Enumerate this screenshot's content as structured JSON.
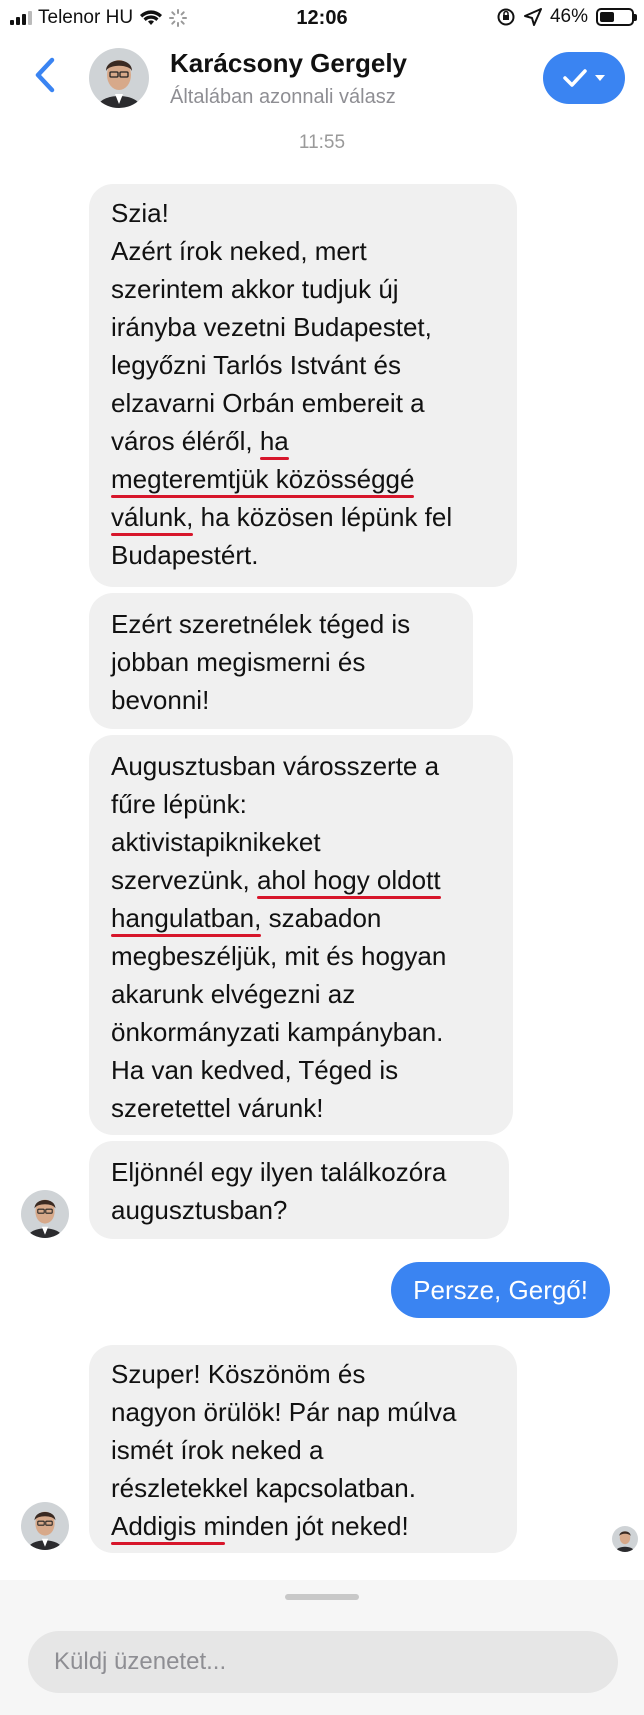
{
  "status": {
    "carrier": "Telenor HU",
    "time": "12:06",
    "battery": "46%",
    "battery_level": 0.46
  },
  "header": {
    "name": "Karácsony Gergely",
    "subtitle": "Általában azonnali válasz"
  },
  "conversation": {
    "timestamp": "11:55",
    "msg1": {
      "l1": "Szia!",
      "l2": "Azért írok neked, mert",
      "l3": "szerintem akkor tudjuk új",
      "l4": "irányba vezetni Budapestet,",
      "l5": "legyőzni Tarlós Istvánt és",
      "l6": "elzavarni Orbán embereit a",
      "l7a": "város éléről, ",
      "l7b": "ha",
      "l8": "megteremtjük közösséggé",
      "l9a": "válunk,",
      "l9b": " ha közösen lépünk fel",
      "l10": "Budapestért."
    },
    "msg2": {
      "l1": "Ezért szeretnélek téged is",
      "l2": "jobban megismerni és",
      "l3": "bevonni!"
    },
    "msg3": {
      "l1": "Augusztusban városszerte a",
      "l2": "fűre lépünk:",
      "l3": "aktivistapiknikeket",
      "l4a": "szervezünk, ",
      "l4b": "ahol hogy oldott",
      "l5a": "hangulatban,",
      "l5b": " szabadon",
      "l6": "megbeszéljük, mit és hogyan",
      "l7": "akarunk elvégezni az",
      "l8": "önkormányzati kampányban.",
      "l9": "Ha van kedved, Téged is",
      "l10": "szeretettel várunk!"
    },
    "msg4": {
      "l1": "Eljönnél egy ilyen találkozóra",
      "l2": "augusztusban?"
    },
    "sent1": "Persze, Gergő!",
    "msg5": {
      "l1": "Szuper! Köszönöm és",
      "l2": "nagyon örülök! Pár nap múlva",
      "l3": "ismét írok neked a",
      "l4": "részletekkel kapcsolatban.",
      "l5a": "Addigis m",
      "l5b": "inden jót neked!"
    }
  },
  "composer": {
    "placeholder": "Küldj üzenetet..."
  },
  "colors": {
    "accent": "#3a84f2",
    "bubble": "#f0f0f0",
    "underline": "#d7162b"
  }
}
